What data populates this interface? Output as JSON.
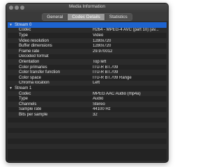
{
  "window": {
    "title": "Media Information"
  },
  "tabs": [
    "General",
    "Codec Details",
    "Statistics"
  ],
  "active_tab": "Codec Details",
  "streams": [
    {
      "label": "Stream 0",
      "props": [
        [
          "Codec",
          "H264 - MPEG-4 AVC (part 10) (av..."
        ],
        [
          "Type",
          "Video"
        ],
        [
          "Video resolution",
          "1280x720"
        ],
        [
          "Buffer dimensions",
          "1280x720"
        ],
        [
          "Frame rate",
          "29.970012"
        ],
        [
          "Decoded format",
          ""
        ],
        [
          "Orientation",
          "Top left"
        ],
        [
          "Color primaries",
          "ITU-R BT.709"
        ],
        [
          "Color transfer function",
          "ITU-R BT.709"
        ],
        [
          "Color space",
          "ITU-R BT.709 Range"
        ],
        [
          "Chroma location",
          "Left"
        ]
      ]
    },
    {
      "label": "Stream 1",
      "props": [
        [
          "Codec",
          "MPEG AAC Audio (mp4a)"
        ],
        [
          "Type",
          "Audio"
        ],
        [
          "Channels",
          "Stereo"
        ],
        [
          "Sample rate",
          "44100 Hz"
        ],
        [
          "Bits per sample",
          "32"
        ]
      ]
    }
  ]
}
